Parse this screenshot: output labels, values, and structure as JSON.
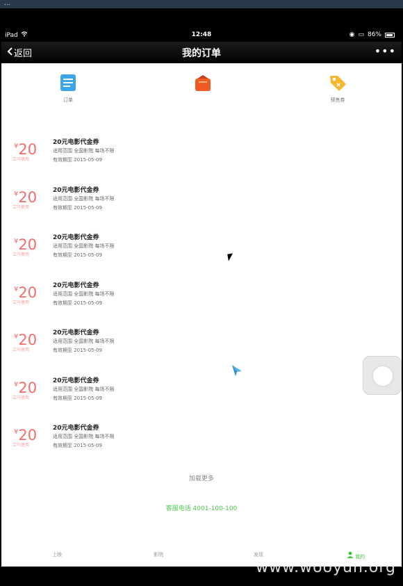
{
  "os_strip": {
    "text": "..."
  },
  "status_bar": {
    "device": "iPad",
    "time": "12:48",
    "battery": "86%",
    "battery_level": 0.86
  },
  "nav": {
    "back_label": "返回",
    "title": "我的订单",
    "more_label": "•••"
  },
  "top_icons": [
    {
      "label": "订单",
      "icon": "order-list-icon",
      "color": "#3aa6e8"
    },
    {
      "label": "",
      "icon": "bag-icon",
      "color": "#f05a23"
    },
    {
      "label": "预售券",
      "icon": "tag-icon",
      "color": "#f6b82a"
    }
  ],
  "coupons": [
    {
      "currency": "¥",
      "price": "20",
      "subtitle": "立马使用",
      "name": "20元电影代金券",
      "scope": "适用范围  全国影院 每场不限",
      "validity": "有效期至  2015-05-09"
    },
    {
      "currency": "¥",
      "price": "20",
      "subtitle": "立马使用",
      "name": "20元电影代金券",
      "scope": "适用范围  全国影院 每场不限",
      "validity": "有效期至  2015-05-09"
    },
    {
      "currency": "¥",
      "price": "20",
      "subtitle": "立马使用",
      "name": "20元电影代金券",
      "scope": "适用范围  全国影院 每场不限",
      "validity": "有效期至  2015-05-09"
    },
    {
      "currency": "¥",
      "price": "20",
      "subtitle": "立马使用",
      "name": "20元电影代金券",
      "scope": "适用范围  全国影院 每场不限",
      "validity": "有效期至  2015-05-09"
    },
    {
      "currency": "¥",
      "price": "20",
      "subtitle": "立马使用",
      "name": "20元电影代金券",
      "scope": "适用范围  全国影院 每场不限",
      "validity": "有效期至  2015-05-09"
    },
    {
      "currency": "¥",
      "price": "20",
      "subtitle": "立马使用",
      "name": "20元电影代金券",
      "scope": "适用范围  全国影院 每场不限",
      "validity": "有效期至  2015-05-09"
    },
    {
      "currency": "¥",
      "price": "20",
      "subtitle": "立马使用",
      "name": "20元电影代金券",
      "scope": "适用范围  全国影院 每场不限",
      "validity": "有效期至  2015-05-09"
    }
  ],
  "load_more": "加载更多",
  "phone": "客服电话  4001-100-100",
  "tabs": [
    {
      "label": "上映",
      "active": false
    },
    {
      "label": "影院",
      "active": false
    },
    {
      "label": "发现",
      "active": false
    },
    {
      "label": "我的",
      "active": true
    }
  ],
  "watermark": "www.wooyun.org"
}
